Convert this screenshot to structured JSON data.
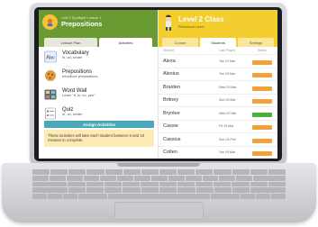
{
  "lesson_panel": {
    "subtitle": "Unit 2 Spotlight Lesson 1",
    "title": "Prepositions",
    "tabs": [
      {
        "label": "Lesson Plan",
        "active": false
      },
      {
        "label": "Activities",
        "active": true
      }
    ],
    "activities": [
      {
        "name": "Vocabulary",
        "description": "in, on, under",
        "icon": "abc-blocks-icon"
      },
      {
        "name": "Prepositions",
        "description": "Introduce prepositions.",
        "icon": "cookie-icon"
      },
      {
        "name": "Word Wall",
        "description": "Learn \"it, is, no, yes\".",
        "icon": "word-wall-icon"
      },
      {
        "name": "Quiz",
        "description": "in, on, under",
        "icon": "quiz-icon"
      }
    ],
    "assign_button": "Assign Activities",
    "notice": "These activities will take each student between 5 and 10 minutes to complete."
  },
  "class_panel": {
    "title": "Level 2 Class",
    "subtitle": "Preschool Level",
    "tabs": [
      {
        "label": "Course",
        "active": false
      },
      {
        "label": "Students",
        "active": true
      },
      {
        "label": "Settings",
        "active": false
      }
    ],
    "columns": {
      "student": "Student",
      "last_played": "Last Played",
      "status": "Status"
    },
    "students": [
      {
        "name": "Alexa",
        "last_played": "Tue 12 Mar",
        "status": "orange"
      },
      {
        "name": "Alexius",
        "last_played": "Tue 19 Mar",
        "status": "orange"
      },
      {
        "name": "Braiden",
        "last_played": "Wed 20 Mar",
        "status": "orange"
      },
      {
        "name": "Britney",
        "last_played": "Sun 03 Mar",
        "status": "orange"
      },
      {
        "name": "Brynlee",
        "last_played": "Wed 20 Mar",
        "status": "green"
      },
      {
        "name": "Cassie",
        "last_played": "Fri 15 Mar",
        "status": "orange"
      },
      {
        "name": "Cassius",
        "last_played": "Sun 24 Feb",
        "status": "orange"
      },
      {
        "name": "Colten",
        "last_played": "Tue 19 Mar",
        "status": "orange"
      }
    ]
  },
  "colors": {
    "lesson_green": "#6a9b32",
    "class_yellow": "#f4cd2e",
    "assign_teal": "#4aa8b8",
    "status_orange": "#f2a23a",
    "status_green": "#4caf3c"
  }
}
